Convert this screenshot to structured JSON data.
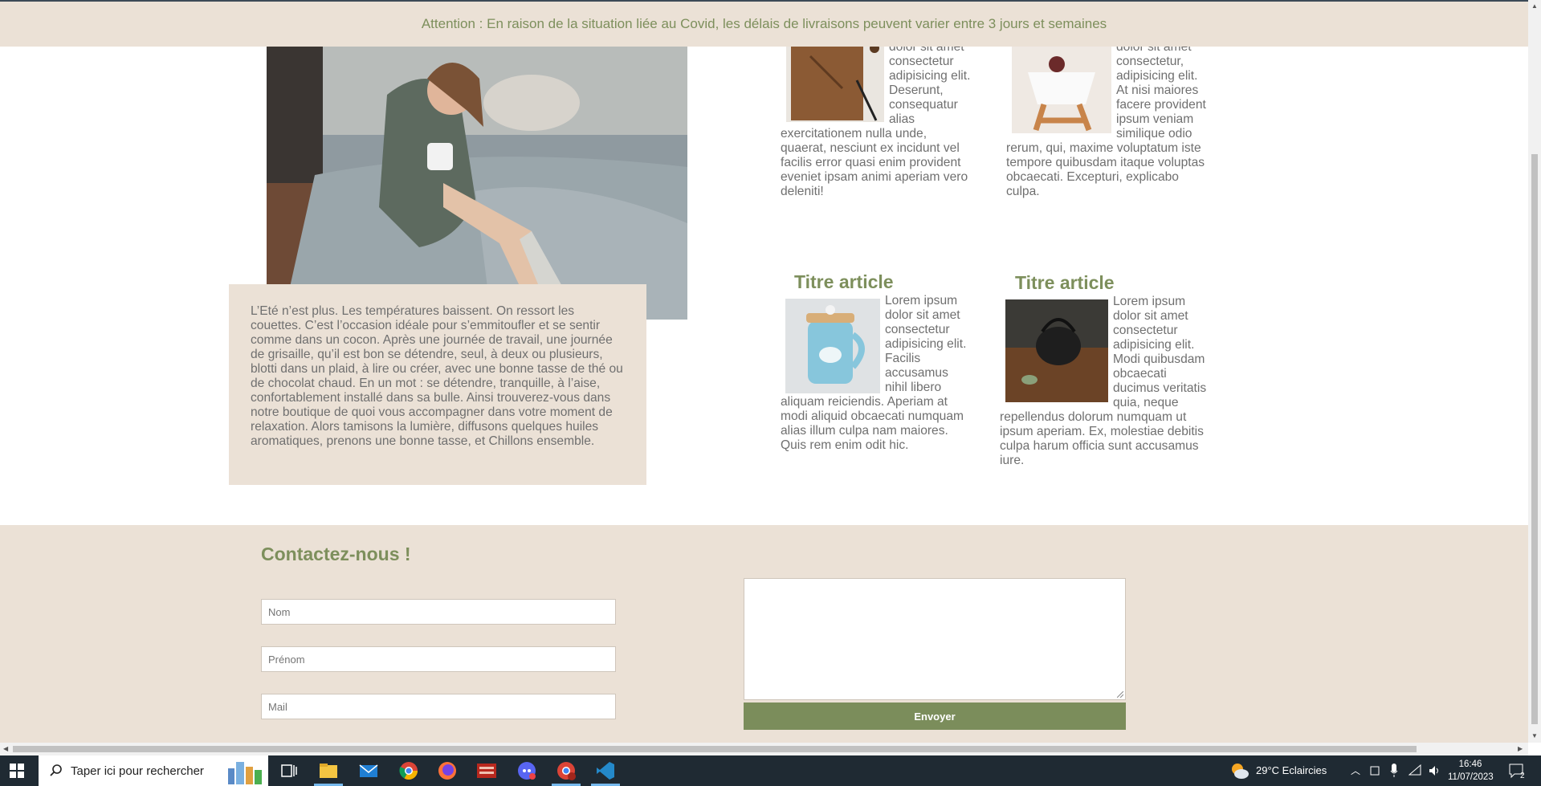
{
  "banner": {
    "text": "Attention : En raison de la situation liée au Covid, les délais de livraisons peuvent varier entre 3 jours et semaines"
  },
  "hero": {
    "text": "L’Eté n’est plus. Les températures baissent. On ressort les couettes. C’est l’occasion idéale pour s’emmitoufler et se sentir comme dans un cocon. Après une journée de travail, une journée de grisaille, qu’il est bon se détendre, seul, à deux ou plusieurs, blotti dans un plaid, à lire ou créer, avec une bonne tasse de thé ou de chocolat chaud. En un mot : se détendre, tranquille, à l’aise, confortablement installé dans sa bulle. Ainsi trouverez-vous dans notre boutique de quoi vous accompagner dans votre moment de relaxation. Alors tamisons la lumière, diffusons quelques huiles aromatiques, prenons une bonne tasse, et Chillons ensemble."
  },
  "articles": [
    {
      "title": "",
      "text": "dolor sit amet consectetur adipisicing elit. Deserunt, consequatur alias exercitationem nulla unde, quaerat, nesciunt ex incidunt vel facilis error quasi enim provident eveniet ipsam animi aperiam vero deleniti!"
    },
    {
      "title": "",
      "text": "dolor sit amet consectetur, adipisicing elit. At nisi maiores facere provident ipsum veniam similique odio rerum, qui, maxime voluptatum iste tempore quibusdam itaque voluptas obcaecati. Excepturi, explicabo culpa."
    },
    {
      "title": "Titre article",
      "text": "Lorem ipsum dolor sit amet consectetur adipisicing elit. Facilis accusamus nihil libero aliquam reiciendis. Aperiam at modi aliquid obcaecati numquam alias illum culpa nam maiores. Quis rem enim odit hic."
    },
    {
      "title": "Titre article",
      "text": "Lorem ipsum dolor sit amet consectetur adipisicing elit. Modi quibusdam obcaecati ducimus veritatis quia, neque repellendus dolorum numquam ut ipsum aperiam. Ex, molestiae debitis culpa harum officia sunt accusamus iure."
    }
  ],
  "contact": {
    "title": "Contactez-nous !",
    "nom_placeholder": "Nom",
    "prenom_placeholder": "Prénom",
    "mail_placeholder": "Mail",
    "message_value": "",
    "send_label": "Envoyer"
  },
  "taskbar": {
    "search_placeholder": "Taper ici pour rechercher",
    "weather": "29°C  Eclaircies",
    "time": "16:46",
    "date": "11/07/2023",
    "notifications": "2"
  },
  "icons": [
    "windows-start-icon",
    "search-icon",
    "task-view-icon",
    "file-explorer-icon",
    "mail-icon",
    "chrome-icon",
    "firefox-icon",
    "voicemeeter-icon",
    "discord-icon",
    "chrome-profile-icon",
    "vscode-icon"
  ],
  "colors": {
    "accent": "#7d8f5c",
    "beige": "#ebe1d6",
    "button": "#7b8d5b"
  }
}
